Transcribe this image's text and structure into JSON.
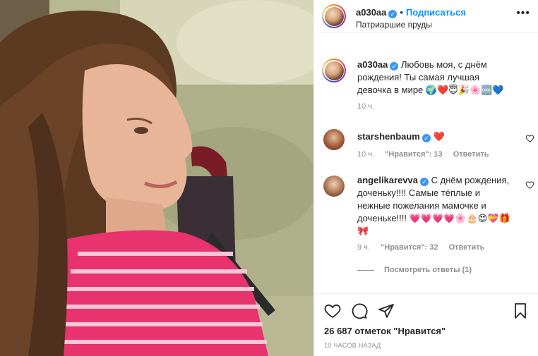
{
  "header": {
    "username": "a030aa",
    "separator": "•",
    "follow_label": "Подписаться",
    "location": "Патриаршие пруды",
    "more_label": "•••"
  },
  "caption": {
    "username": "a030aa",
    "text": "Любовь моя, с днём рождения! Ты самая лучшая девочка в мире 🌍❤️😇🎉🌸🆒💙",
    "time": "10 ч."
  },
  "comments": [
    {
      "username": "starshenbaum",
      "text": "❤️",
      "time": "10 ч.",
      "likes": "\"Нравится\": 13",
      "reply": "Ответить"
    },
    {
      "username": "angelikarevva",
      "text": "С днём рождения, доченьку!!!! Самые тёплые и нежные пожелания мамочке и доченьке!!!! 💗💗💗💗🌸🎂😍💝🎁🎀",
      "time": "9 ч.",
      "likes": "\"Нравится\": 32",
      "reply": "Ответить"
    }
  ],
  "view_replies": "Посмотреть ответы (1)",
  "likes_count": "26 687 отметок \"Нравится\"",
  "posted_time": "10 ЧАСОВ НАЗАД",
  "icons": [
    "heart-icon",
    "comment-icon",
    "share-icon",
    "bookmark-icon",
    "verified-icon",
    "more-icon"
  ],
  "colors": {
    "accent": "#0095f6",
    "verified": "#3897f0",
    "muted": "#8e8e8e"
  }
}
